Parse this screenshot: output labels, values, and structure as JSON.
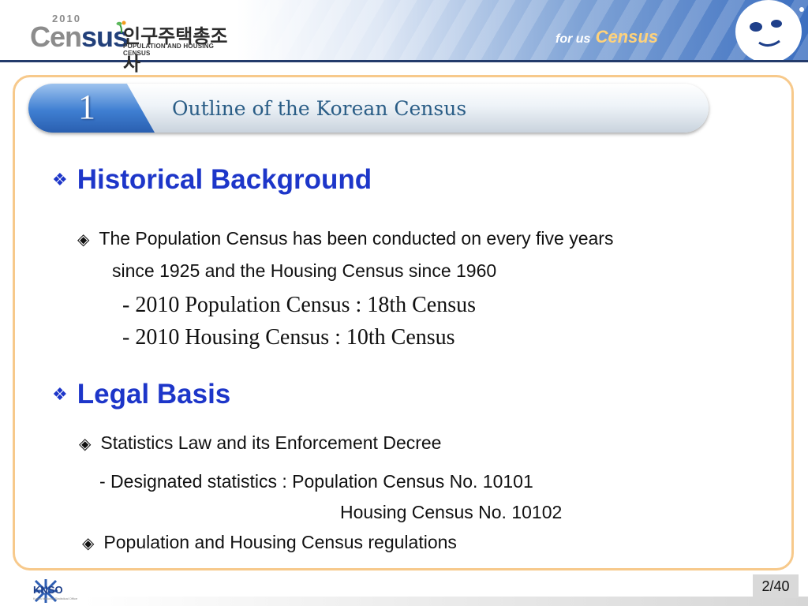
{
  "header": {
    "logo_year": "2010",
    "logo_word_a": "Cen",
    "logo_word_b": "sus",
    "logo_korean": "인구주택총조사",
    "logo_subtitle": "POPULATION AND HOUSING CENSUS",
    "slogan_a": "for us",
    "slogan_b": "Census"
  },
  "title": {
    "number": "1",
    "text": "Outline of the Korean Census"
  },
  "sections": [
    {
      "heading": "Historical Background",
      "lines": [
        "The Population Census has been conducted on every five years",
        "since 1925 and the Housing Census since 1960",
        "- 2010 Population Census : 18th Census",
        "- 2010 Housing Census : 10th Census"
      ]
    },
    {
      "heading": "Legal Basis",
      "lines": [
        "Statistics Law and its Enforcement Decree",
        "- Designated statistics : Population Census  No. 10101",
        "Housing   Census  No. 10102",
        "Population and Housing Census regulations"
      ]
    }
  ],
  "icons": {
    "heading_bullet": "❖",
    "item_bullet": "◈"
  },
  "footer": {
    "org": "KNSO",
    "org_sub": "Korea National Statistical Office",
    "page": "2/40"
  },
  "colors": {
    "heading": "#1d36c9",
    "title_text": "#2a5d86",
    "frame_border": "#f7c98b",
    "header_rule": "#233a6b"
  }
}
